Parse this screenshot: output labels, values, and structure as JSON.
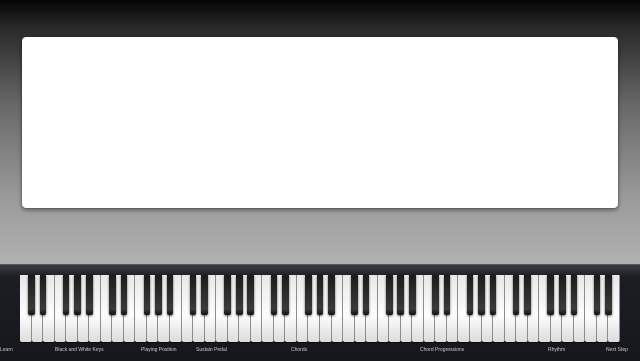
{
  "keyboard": {
    "white_key_count": 52,
    "black_pattern": [
      1,
      1,
      0,
      1,
      1,
      1,
      0
    ]
  },
  "nav": {
    "items": [
      {
        "id": "learn",
        "label": "Learn"
      },
      {
        "id": "black-white-keys",
        "label": "Black and White Keys"
      },
      {
        "id": "playing-position",
        "label": "Playing Position"
      },
      {
        "id": "sustain-pedal",
        "label": "Sustain Pedal"
      },
      {
        "id": "chords",
        "label": "Chords"
      },
      {
        "id": "chord-progressions",
        "label": "Chord Progressions"
      },
      {
        "id": "rhythm",
        "label": "Rhythm"
      },
      {
        "id": "next-step",
        "label": "Next Step"
      }
    ]
  }
}
